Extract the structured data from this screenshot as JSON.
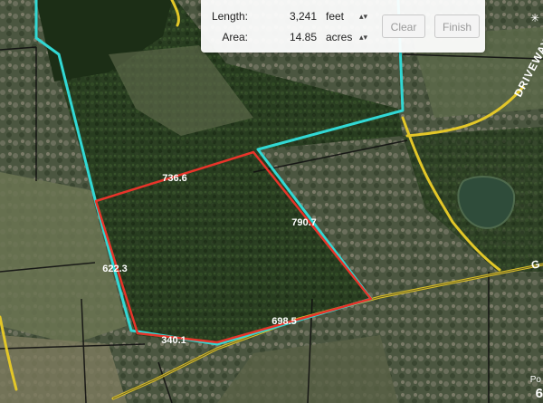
{
  "measure_panel": {
    "length_label": "Length:",
    "length_value": "3,241",
    "length_unit": "feet",
    "area_label": "Area:",
    "area_value": "14.85",
    "area_unit": "acres",
    "clear_label": "Clear",
    "finish_label": "Finish"
  },
  "segment_lengths": [
    "736.6",
    "790.7",
    "622.3",
    "698.5",
    "340.1"
  ],
  "road_labels": [
    "DRIVEWAY",
    "G"
  ],
  "corner_text": [
    "Po",
    "6"
  ],
  "colors": {
    "measured_boundary": "#e8342a",
    "parcel_outline": "#31d8d4",
    "road": "#e3c728",
    "parcel_lines": "#111111"
  }
}
